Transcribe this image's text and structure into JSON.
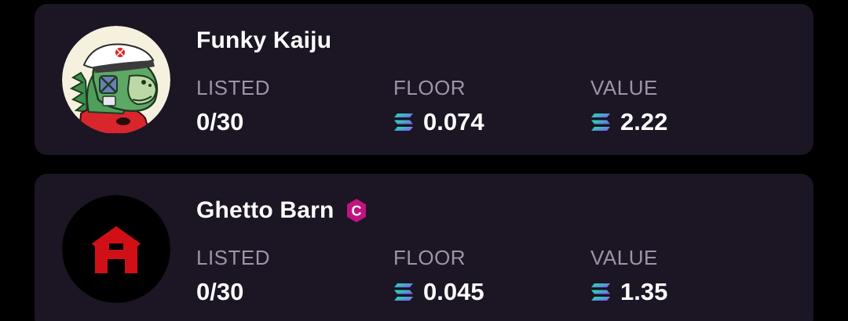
{
  "collections": [
    {
      "name": "Funky Kaiju",
      "avatar_icon": "funky-kaiju-dinosaur-avatar",
      "listed_label": "LISTED",
      "listed_value": "0/30",
      "floor_label": "FLOOR",
      "floor_value": "0.074",
      "value_label": "VALUE",
      "value_value": "2.22"
    },
    {
      "name": "Ghetto Barn",
      "avatar_icon": "red-barn-logo-avatar",
      "badge_letter": "C",
      "listed_label": "LISTED",
      "listed_value": "0/30",
      "floor_label": "FLOOR",
      "floor_value": "0.045",
      "value_label": "VALUE",
      "value_value": "1.35"
    }
  ],
  "colors": {
    "background": "#000000",
    "card": "#1b1524",
    "label": "#9d95a6",
    "text": "#ffffff",
    "badge": "#c2127f",
    "barn_red": "#d10f17"
  }
}
